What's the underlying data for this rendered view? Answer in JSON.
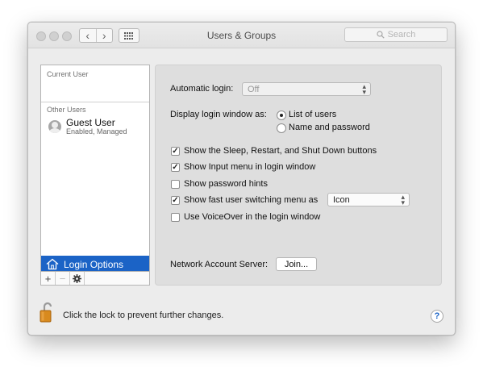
{
  "window": {
    "title": "Users & Groups"
  },
  "toolbar": {
    "back_glyph": "‹",
    "forward_glyph": "›",
    "search_placeholder": "Search",
    "icons": [
      "close-icon",
      "minimize-icon",
      "zoom-icon",
      "back-icon",
      "forward-icon",
      "show-all-grid-icon",
      "search-icon"
    ]
  },
  "sidebar": {
    "current_user_label": "Current User",
    "other_users_label": "Other Users",
    "guest": {
      "name": "Guest User",
      "status": "Enabled, Managed"
    },
    "login_options_label": "Login Options",
    "add_glyph": "+",
    "remove_glyph": "−",
    "selected_color": "#1b63c6"
  },
  "panel": {
    "automatic_login": {
      "label": "Automatic login:",
      "value": "Off"
    },
    "display_login": {
      "label": "Display login window as:",
      "options": [
        {
          "label": "List of users",
          "selected": true
        },
        {
          "label": "Name and password",
          "selected": false
        }
      ]
    },
    "checkboxes": {
      "sleep_restart": {
        "label": "Show the Sleep, Restart, and Shut Down buttons",
        "checked": true
      },
      "input_menu": {
        "label": "Show Input menu in login window",
        "checked": true
      },
      "password_hints": {
        "label": "Show password hints",
        "checked": false
      },
      "fast_user_switching": {
        "label": "Show fast user switching menu as",
        "checked": true,
        "value": "Icon"
      },
      "voiceover": {
        "label": "Use VoiceOver in the login window",
        "checked": false
      }
    },
    "network_server": {
      "label": "Network Account Server:",
      "button": "Join..."
    },
    "check_glyph": "✓",
    "popup_arrows": [
      "▴",
      "▾"
    ]
  },
  "footer": {
    "lock_text": "Click the lock to prevent further changes.",
    "help_glyph": "?"
  }
}
